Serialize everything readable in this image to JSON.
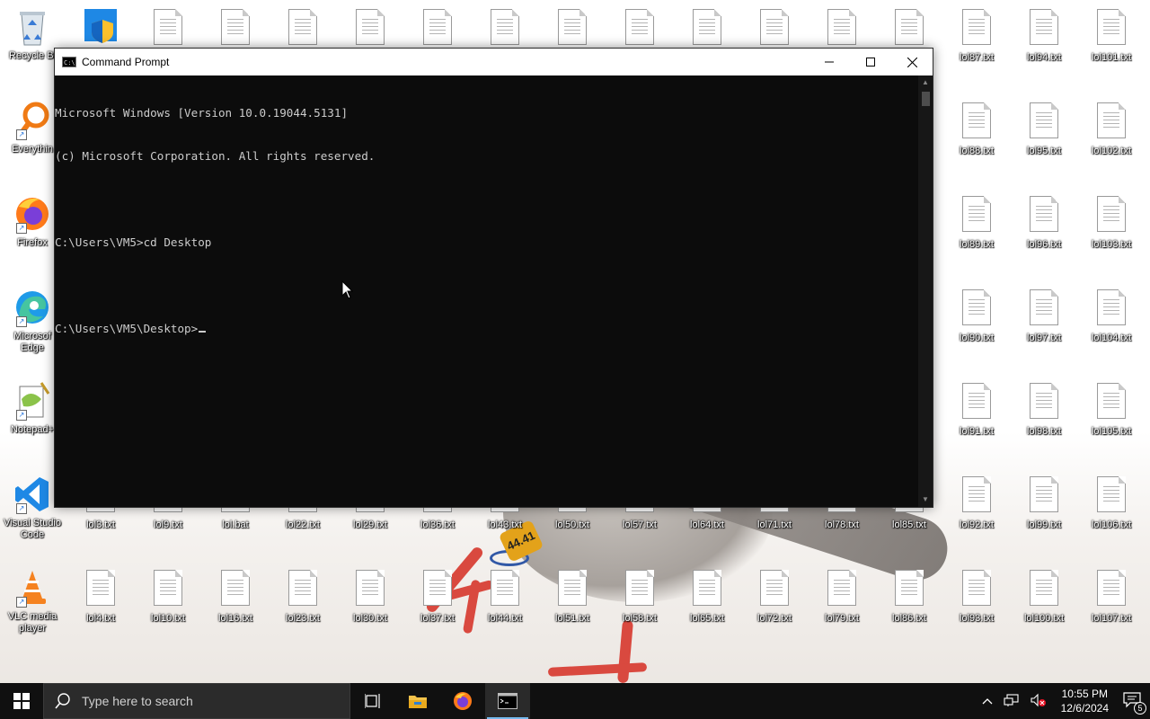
{
  "desktop": {
    "icons_left": [
      {
        "label": "Recycle Bi",
        "type": "recycle"
      },
      {
        "label": "Everythin",
        "type": "everything"
      },
      {
        "label": "Firefox",
        "type": "firefox"
      },
      {
        "label": "Microsof Edge",
        "type": "edge"
      },
      {
        "label": "Notepad+",
        "type": "notepadpp"
      },
      {
        "label": "Visual Studio Code",
        "type": "vscode"
      },
      {
        "label": "VLC media player",
        "type": "vlc"
      }
    ],
    "files_row_585": [
      "lol3.txt",
      "lol9.txt",
      "lol.bat",
      "lol22.txt",
      "lol29.txt",
      "lol36.txt",
      "lol43.txt",
      "lol50.txt",
      "lol57.txt",
      "lol64.txt",
      "lol71.txt",
      "lol78.txt",
      "lol85.txt",
      "lol92.txt",
      "lol99.txt",
      "lol106.txt"
    ],
    "files_row_690": [
      "lol4.txt",
      "lol10.txt",
      "lol16.txt",
      "lol23.txt",
      "lol30.txt",
      "lol37.txt",
      "lol44.txt",
      "lol51.txt",
      "lol58.txt",
      "lol65.txt",
      "lol72.txt",
      "lol79.txt",
      "lol86.txt",
      "lol93.txt",
      "lol100.txt",
      "lol107.txt"
    ],
    "files_right_cols": [
      [
        "lol87.txt",
        "lol88.txt",
        "lol89.txt",
        "lol90.txt",
        "lol91.txt"
      ],
      [
        "lol94.txt",
        "lol95.txt",
        "lol96.txt",
        "lol97.txt",
        "lol98.txt"
      ],
      [
        "lol101.txt",
        "lol102.txt",
        "lol103.txt",
        "lol104.txt",
        "lol105.txt"
      ]
    ],
    "wallpaper_tag": "44.41"
  },
  "window": {
    "title": "Command Prompt",
    "minimize_label": "—",
    "maximize_label": "☐",
    "close_label": "✕",
    "console_lines": [
      "Microsoft Windows [Version 10.0.19044.5131]",
      "(c) Microsoft Corporation. All rights reserved.",
      "",
      "C:\\Users\\VM5>cd Desktop",
      "",
      "C:\\Users\\VM5\\Desktop>"
    ]
  },
  "taskbar": {
    "search_placeholder": "Type here to search",
    "time": "10:55 PM",
    "date": "12/6/2024",
    "notification_count": "5"
  }
}
